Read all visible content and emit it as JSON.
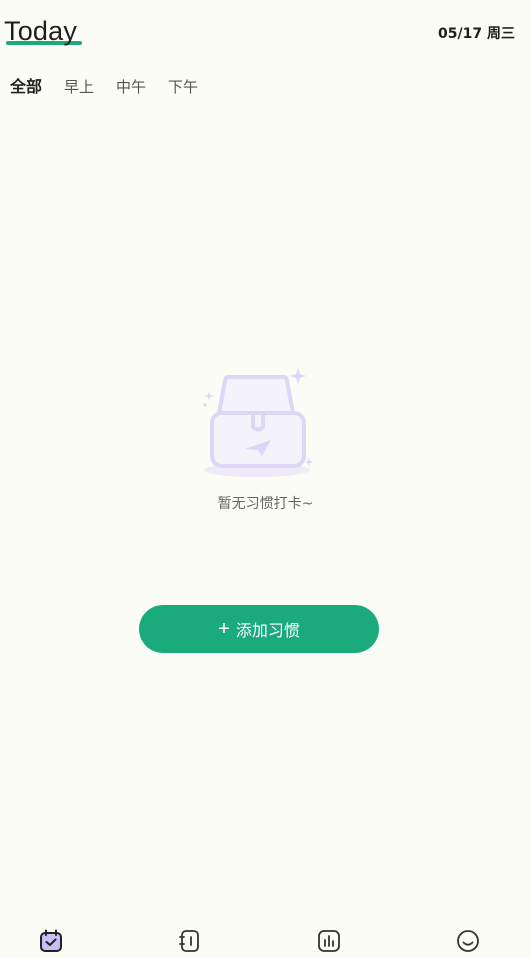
{
  "header": {
    "title": "Today",
    "date": "05/17 周三"
  },
  "tabs": [
    {
      "label": "全部",
      "active": true
    },
    {
      "label": "早上",
      "active": false
    },
    {
      "label": "中午",
      "active": false
    },
    {
      "label": "下午",
      "active": false
    }
  ],
  "empty": {
    "message": "暂无习惯打卡~"
  },
  "add_button": {
    "label": "添加习惯",
    "icon": "plus-icon"
  },
  "bottom_nav": [
    {
      "icon": "calendar-check-icon",
      "active": true
    },
    {
      "icon": "notebook-icon",
      "active": false
    },
    {
      "icon": "bar-chart-icon",
      "active": false
    },
    {
      "icon": "smiley-icon",
      "active": false
    }
  ],
  "colors": {
    "accent": "#1BAA7C",
    "background": "#FCFCF6",
    "illustration": "#DDD6F6"
  }
}
